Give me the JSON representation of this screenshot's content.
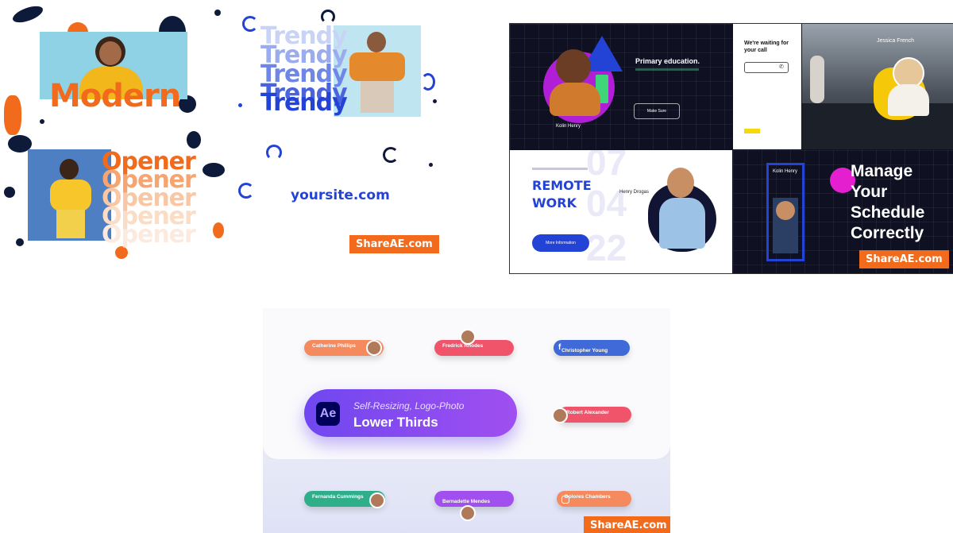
{
  "top_left": {
    "words": {
      "modern": "Modern",
      "trendy": "Trendy",
      "opener": "Opener",
      "site": "yoursite.com"
    }
  },
  "top_right": {
    "education": {
      "title": "Primary education.",
      "person": "Kolin Henry",
      "button": "Make Sure"
    },
    "waiting": {
      "title": "We're waiting for your call"
    },
    "presenter": {
      "name": "Jessica French"
    },
    "remote": {
      "title": "REMOTE WORK",
      "person": "Henry Drogas",
      "numbers": [
        "07",
        "04",
        "22"
      ],
      "button": "More Information"
    },
    "manage": {
      "title": "Manage Your Schedule Correctly",
      "person": "Kolin Henry"
    }
  },
  "bottom": {
    "center_title_1": "Self-Resizing, Logo-Photo",
    "center_title_2": "Lower Thirds",
    "ae_label": "Ae",
    "pills": {
      "p1": "Catherine Phillips",
      "p2": "Fredrick Rhodes",
      "p3": "Christopher Young",
      "p4": "Robert Alexander",
      "p5": "Fernanda Cummings",
      "p6": "Bernadette Mendes",
      "p7": "Dolores Chambers"
    }
  },
  "watermarks": {
    "left": "ShareAE.com",
    "right": "ShareAE.com",
    "bottom": "ShareAE.com"
  },
  "colors": {
    "orange": "#f26a1b",
    "navy": "#0e1a3a",
    "blue": "#2342d6",
    "purple": "#7b3fe4",
    "dark": "#0f1022"
  }
}
